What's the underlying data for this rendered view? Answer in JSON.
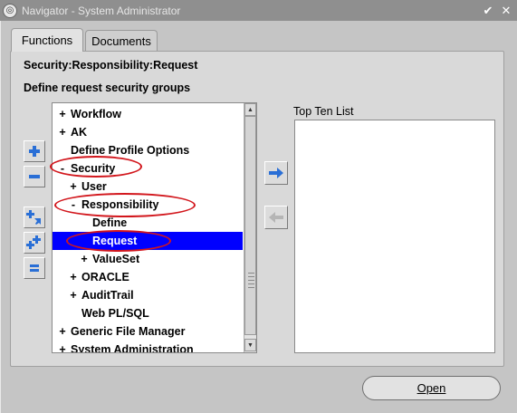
{
  "window": {
    "title": "Navigator - System Administrator",
    "minimize_glyph": "✔",
    "close_glyph": "✕"
  },
  "tabs": [
    {
      "label": "Functions",
      "active": true
    },
    {
      "label": "Documents",
      "active": false
    }
  ],
  "breadcrumb": "Security:Responsibility:Request",
  "description": "Define request security groups",
  "tree": {
    "items": [
      {
        "toggle": "+",
        "label": "Workflow",
        "level": 0,
        "selected": false
      },
      {
        "toggle": "+",
        "label": "AK",
        "level": 0,
        "selected": false
      },
      {
        "toggle": "",
        "label": "Define Profile Options",
        "level": 0,
        "selected": false
      },
      {
        "toggle": "-",
        "label": "Security",
        "level": 0,
        "selected": false
      },
      {
        "toggle": "+",
        "label": "User",
        "level": 1,
        "selected": false
      },
      {
        "toggle": "-",
        "label": "Responsibility",
        "level": 1,
        "selected": false
      },
      {
        "toggle": "",
        "label": "Define",
        "level": 2,
        "selected": false
      },
      {
        "toggle": "",
        "label": "Request",
        "level": 2,
        "selected": true
      },
      {
        "toggle": "+",
        "label": "ValueSet",
        "level": 2,
        "selected": false
      },
      {
        "toggle": "+",
        "label": "ORACLE",
        "level": 1,
        "selected": false
      },
      {
        "toggle": "+",
        "label": "AuditTrail",
        "level": 1,
        "selected": false
      },
      {
        "toggle": "",
        "label": "Web PL/SQL",
        "level": 1,
        "selected": false
      },
      {
        "toggle": "+",
        "label": "Generic File Manager",
        "level": 0,
        "selected": false
      },
      {
        "toggle": "+",
        "label": "System Administration",
        "level": 0,
        "selected": false
      }
    ]
  },
  "top_ten": {
    "label": "Top Ten List",
    "items": []
  },
  "buttons": {
    "open_label": "Open"
  },
  "colors": {
    "selection": "#0000ff",
    "annotation": "#d2161c",
    "icon_blue": "#2a6fd6"
  }
}
